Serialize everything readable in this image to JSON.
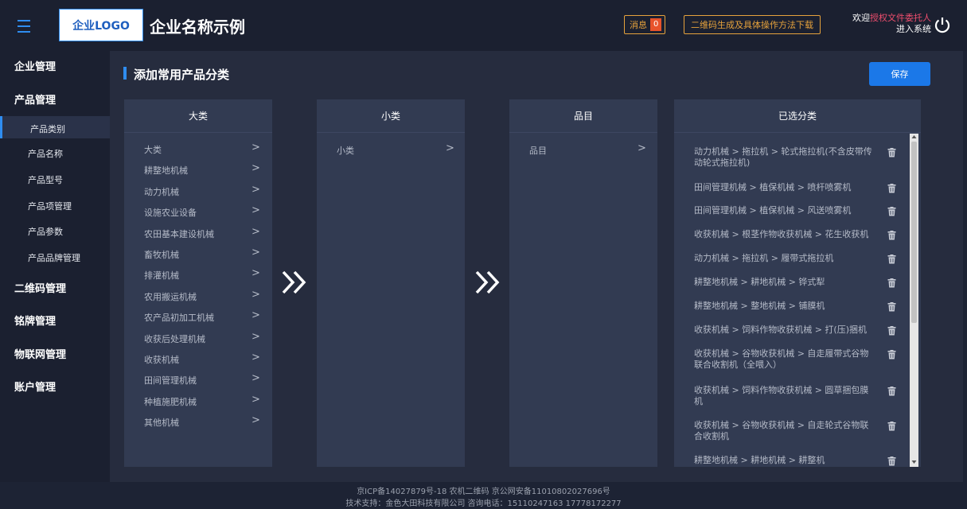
{
  "header": {
    "logo_text": "企业LOGO",
    "company_name": "企业名称示例",
    "message_label": "消息",
    "message_count": "0",
    "qr_download_label": "二维码生成及具体操作方法下载",
    "welcome_prefix": "欢迎",
    "user_name": "授权文件委托人",
    "enter_system": "进入系统"
  },
  "sidebar": {
    "enterprise": "企业管理",
    "product": "产品管理",
    "product_sub": [
      "产品类别",
      "产品名称",
      "产品型号",
      "产品项管理",
      "产品参数",
      "产品品牌管理"
    ],
    "qrcode": "二维码管理",
    "nameplate": "铭牌管理",
    "iot": "物联网管理",
    "account": "账户管理"
  },
  "page": {
    "title": "添加常用产品分类",
    "save_label": "保存"
  },
  "columns": {
    "major": {
      "header": "大类",
      "items": [
        "大类",
        "耕整地机械",
        "动力机械",
        "设施农业设备",
        "农田基本建设机械",
        "畜牧机械",
        "排灌机械",
        "农用搬运机械",
        "农产品初加工机械",
        "收获后处理机械",
        "收获机械",
        "田间管理机械",
        "种植施肥机械",
        "其他机械"
      ]
    },
    "minor": {
      "header": "小类",
      "items": [
        "小类"
      ]
    },
    "item": {
      "header": "品目",
      "items": [
        "品目"
      ]
    },
    "selected": {
      "header": "已选分类",
      "items": [
        [
          "动力机械 > 拖拉机 > 轮式拖拉机(不含皮带传",
          "动轮式拖拉机)"
        ],
        [
          "田间管理机械 > 植保机械 > 喷杆喷雾机"
        ],
        [
          "田间管理机械 > 植保机械 > 风送喷雾机"
        ],
        [
          "收获机械 > 根茎作物收获机械 > 花生收获机"
        ],
        [
          "动力机械 > 拖拉机 > 履带式拖拉机"
        ],
        [
          "耕整地机械 > 耕地机械 > 铧式犁"
        ],
        [
          "耕整地机械 > 整地机械 > 铺膜机"
        ],
        [
          "收获机械 > 饲料作物收获机械 > 打(压)捆机"
        ],
        [
          "收获机械 > 谷物收获机械 > 自走履带式谷物",
          "联合收割机（全喂入）"
        ],
        [
          "收获机械 > 饲料作物收获机械 > 圆草捆包膜",
          "机"
        ],
        [
          "收获机械 > 谷物收获机械 > 自走轮式谷物联",
          "合收割机"
        ],
        [
          "耕整地机械 > 耕地机械 > 耕整机"
        ]
      ]
    }
  },
  "footer": {
    "line1": "京ICP备14027879号-18 农机二维码 京公网安备11010802027696号",
    "line2": "技术支持：金色大田科技有限公司    咨询电话：15110247163  17778172277"
  },
  "colors": {
    "accent": "#2f8df0",
    "warning": "#e6a23c",
    "user": "#f04e6e"
  }
}
